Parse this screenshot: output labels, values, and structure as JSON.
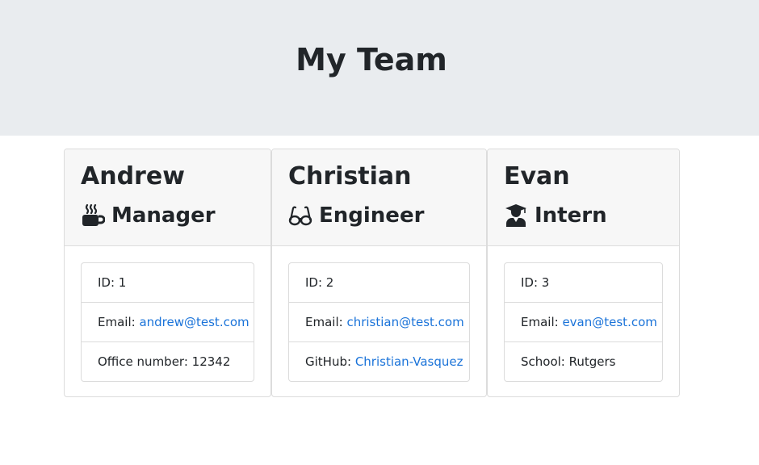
{
  "header": {
    "title": "My Team"
  },
  "team": [
    {
      "name": "Andrew",
      "role": "Manager",
      "role_icon": "coffee-mug-icon",
      "id_label": "ID: 1",
      "email_prefix": "Email: ",
      "email": "andrew@test.com",
      "extra_prefix": "Office number: 12342",
      "extra_link": ""
    },
    {
      "name": "Christian",
      "role": "Engineer",
      "role_icon": "glasses-icon",
      "id_label": "ID: 2",
      "email_prefix": "Email: ",
      "email": "christian@test.com",
      "extra_prefix": "GitHub: ",
      "extra_link": "Christian-Vasquez"
    },
    {
      "name": "Evan",
      "role": "Intern",
      "role_icon": "graduate-icon",
      "id_label": "ID: 3",
      "email_prefix": "Email: ",
      "email": "evan@test.com",
      "extra_prefix": "School: Rutgers",
      "extra_link": ""
    }
  ],
  "colors": {
    "header_bg": "#e9ecef",
    "card_header_bg": "#f7f7f7",
    "link": "#1a73d9",
    "text": "#212529"
  }
}
